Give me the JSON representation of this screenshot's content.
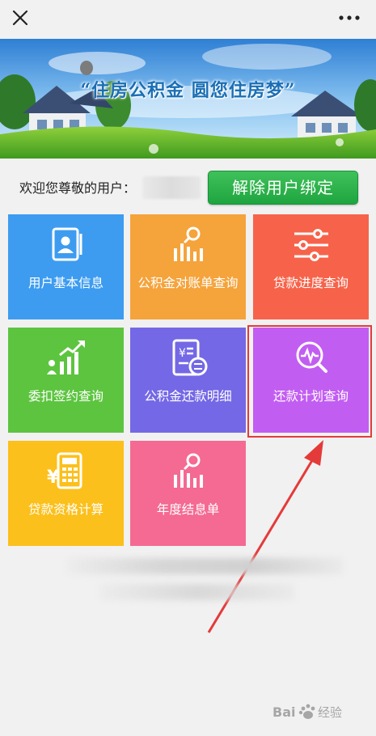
{
  "banner": {
    "slogan": "“住房公积金 圆您住房梦”"
  },
  "welcome": {
    "label": "欢迎您尊敬的用户：",
    "unbind_button": "解除用户绑定"
  },
  "tiles": [
    {
      "label": "用户基本信息",
      "icon": "user-card-icon",
      "color": "#3d9cf0"
    },
    {
      "label": "公积金对账单查询",
      "icon": "bar-chart-search-icon",
      "color": "#f5a33b"
    },
    {
      "label": "贷款进度查询",
      "icon": "sliders-icon",
      "color": "#f7634a"
    },
    {
      "label": "委扣签约查询",
      "icon": "growth-chart-icon",
      "color": "#5dc440"
    },
    {
      "label": "公积金还款明细",
      "icon": "repayment-detail-icon",
      "color": "#7468e6"
    },
    {
      "label": "还款计划查询",
      "icon": "search-pulse-icon",
      "color": "#c25df2"
    },
    {
      "label": "贷款资格计算",
      "icon": "calculator-yuan-icon",
      "color": "#fcc01c"
    },
    {
      "label": "年度结息单",
      "icon": "bar-chart-search-icon",
      "color": "#f46a92"
    }
  ],
  "annotation": {
    "box_color": "#e53a3a",
    "arrow_color": "#e53a3a"
  },
  "watermark": {
    "text": "Bai 经验"
  }
}
